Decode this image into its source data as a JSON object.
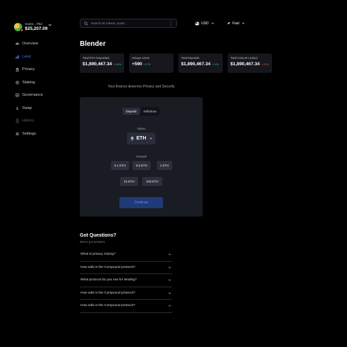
{
  "account": {
    "name": "0xd3e...7f6d",
    "balance": "$25,207.09"
  },
  "sidebar": {
    "items": [
      {
        "label": "Overview"
      },
      {
        "label": "Lend"
      },
      {
        "label": "Privacy"
      },
      {
        "label": "Staking"
      },
      {
        "label": "Governance"
      },
      {
        "label": "Swap"
      },
      {
        "label": "History"
      },
      {
        "label": "Settings"
      }
    ],
    "active": "Lend"
  },
  "search": {
    "placeholder": "Search for tokens, pools..."
  },
  "topbar": {
    "currency": "USD",
    "speed": "Fast"
  },
  "page": {
    "title": "Blender",
    "tagline": "Your finance deserves Privacy and Security"
  },
  "stats": [
    {
      "label": "Total ETH Deposited",
      "value": "$1,890,467.34",
      "delta": "+4.56%",
      "trend": "up"
    },
    {
      "label": "Unique Users",
      "value": "+590",
      "delta": "+0.7%",
      "trend": "up"
    },
    {
      "label": "Total Deposits",
      "value": "$1,890,467.34",
      "delta": "+1.2%",
      "trend": "up"
    },
    {
      "label": "Total Amount Locked",
      "value": "$1,890,467.34",
      "delta": "-1.02%",
      "trend": "down"
    }
  ],
  "card": {
    "tabs": [
      "Deposit",
      "Withdraw"
    ],
    "active_tab": "Deposit",
    "token_label": "Token",
    "token": "ETH",
    "amount_label": "Amount",
    "amounts": [
      "0.1 ETH",
      "0.5 ETH",
      "1 ETH",
      "10 ETH",
      "100 ETH"
    ],
    "continue_label": "Continue"
  },
  "faq": {
    "title": "Got Questions?",
    "subtitle": "We've got answers",
    "items": [
      "What is privacy mixing?",
      "How safe is the Compound protocol?",
      "What protocol do you use for lending?",
      "How safe is the Compound protocol?",
      "How safe is the Compound protocol?"
    ]
  },
  "colors": {
    "background": "#000000",
    "card": "#1a1c24",
    "accent": "#4a7bf2",
    "positive": "#38c172",
    "negative": "#e0524a"
  }
}
